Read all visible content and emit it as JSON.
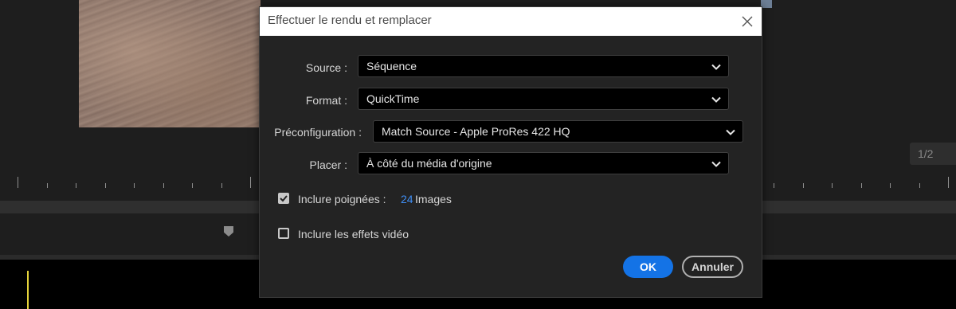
{
  "background": {
    "page_counter": "1/2",
    "playhead_color": "#e5d33a"
  },
  "dialog": {
    "title": "Effectuer le rendu et remplacer",
    "close_icon": "close-icon",
    "source": {
      "label": "Source :",
      "value": "Séquence"
    },
    "format": {
      "label": "Format :",
      "value": "QuickTime"
    },
    "preset": {
      "label": "Préconfiguration :",
      "value": "Match Source - Apple ProRes 422 HQ"
    },
    "placer": {
      "label": "Placer :",
      "value": "À côté du média d'origine"
    },
    "include_handles": {
      "label": "Inclure poignées :",
      "checked": true,
      "count": "24",
      "unit": "Images"
    },
    "include_effects": {
      "label": "Inclure les effets vidéo",
      "checked": false
    },
    "ok_label": "OK",
    "cancel_label": "Annuler",
    "accent_color": "#1473e6",
    "link_color": "#3f8ef5"
  }
}
